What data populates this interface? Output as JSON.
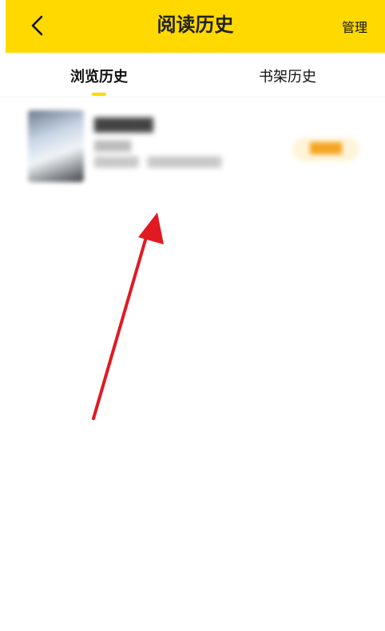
{
  "header": {
    "title": "阅读历史",
    "manage_label": "管理",
    "background_color": "#FFD900",
    "back_icon": "chevron-left-icon"
  },
  "tabs": [
    {
      "label": "浏览历史",
      "active": true
    },
    {
      "label": "书架历史",
      "active": false
    }
  ],
  "history_items": [
    {
      "title": "██████",
      "meta": "█████",
      "progress": "██████ · ██████████",
      "action_label": "████"
    }
  ],
  "annotation": {
    "type": "arrow",
    "color": "#E11A22"
  }
}
